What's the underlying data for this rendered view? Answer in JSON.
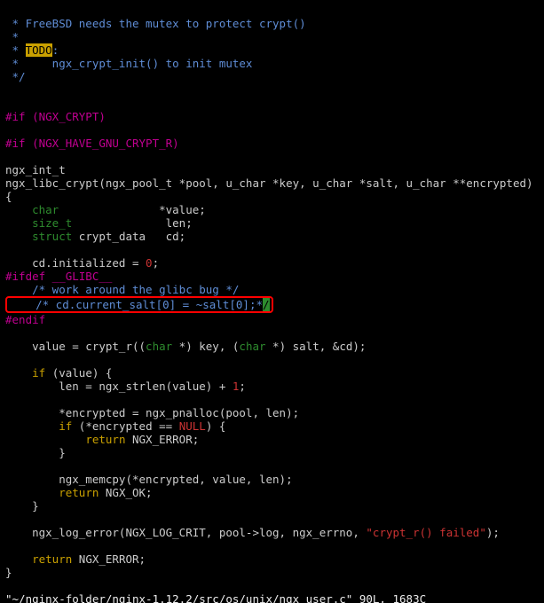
{
  "file_path_info": "\"~/nginx-folder/nginx-1.12.2/src/os/unix/ngx_user.c\" 90L, 1683C",
  "comment_block": {
    "l1": " * FreeBSD needs the mutex to protect crypt()",
    "l2": " *",
    "l3_prefix": " * ",
    "l3_todo": "TODO",
    "l3_suffix": ":",
    "l4": " *     ngx_crypt_init() to init mutex",
    "l5": " */"
  },
  "pp": {
    "if_crypt": "#if (NGX_CRYPT)",
    "if_gnu": "#if (NGX_HAVE_GNU_CRYPT_R)",
    "ifdef_glibc": "#ifdef __GLIBC__",
    "endif": "#endif"
  },
  "kw": {
    "char": "char",
    "size_t": "size_t",
    "struct": "struct",
    "if": "if",
    "return": "return"
  },
  "decl": {
    "ret_type": "ngx_int_t",
    "fn_sig_pre": "ngx_libc_crypt(ngx_pool_t *pool, u_char *key, u_char *salt, u_char **encrypted)",
    "brace_open": "{",
    "brace_close": "}",
    "value_decl_sp": "               *value;",
    "len_decl_sp": "              len;",
    "cd_decl_sp": " crypt_data   cd;"
  },
  "body": {
    "cd_init_pre": "    cd.initialized = ",
    "zero": "0",
    "cd_init_post": ";",
    "glibc_comment": "    /* work around the glibc bug */",
    "boxed_pre": "    /* cd.current_salt[",
    "boxed_idx1": "0",
    "boxed_mid": "] = ~salt[",
    "boxed_idx2": "0",
    "boxed_post_pre": "];*",
    "boxed_cursor": "/",
    "crypt_call_pre": "    value = crypt_r((",
    "crypt_call_char1": "char",
    "crypt_call_mid1": " *) key, (",
    "crypt_call_char2": "char",
    "crypt_call_mid2": " *) salt, &cd);",
    "if_value": "    if (value) {",
    "len_assign_pre": "        len = ngx_strlen(value) + ",
    "one": "1",
    "len_assign_post": ";",
    "enc_assign": "        *encrypted = ngx_pnalloc(pool, len);",
    "if_enc_null_pre": "        if (*encrypted == ",
    "null": "NULL",
    "if_enc_null_post": ") {",
    "ret_err_inner": "             NGX_ERROR;",
    "close_inner": "        }",
    "memcpy": "        ngx_memcpy(*encrypted, value, len);",
    "ret_ok": "         NGX_OK;",
    "close_ifvalue": "    }",
    "log_err_pre": "    ngx_log_error(NGX_LOG_CRIT, pool->log, ngx_errno, ",
    "log_str": "\"crypt_r() failed\"",
    "log_err_post": ");",
    "ret_err_outer": "     NGX_ERROR;",
    "ret_kw_sp12": "            ",
    "ret_kw_sp8": "        ",
    "ret_kw_sp4": "    "
  }
}
